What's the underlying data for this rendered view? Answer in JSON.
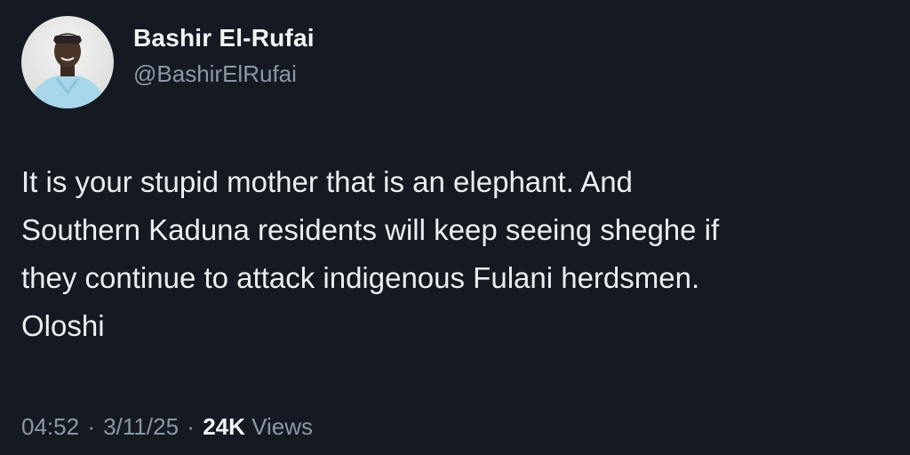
{
  "tweet": {
    "author": {
      "display_name": "Bashir El-Rufai",
      "handle": "@BashirElRufai",
      "avatar_icon": "user-avatar-photo"
    },
    "text": "It is your stupid mother that is an elephant. And\nSouthern Kaduna residents will keep seeing sheghe if\nthey continue to attack indigenous Fulani herdsmen.\nOloshi",
    "meta": {
      "time": "04:52",
      "separator": "·",
      "date": "3/11/25",
      "views_count": "24K",
      "views_label": "Views"
    }
  },
  "colors": {
    "background": "#151a22",
    "text_primary": "#eceef0",
    "text_secondary": "#8b98a5"
  }
}
